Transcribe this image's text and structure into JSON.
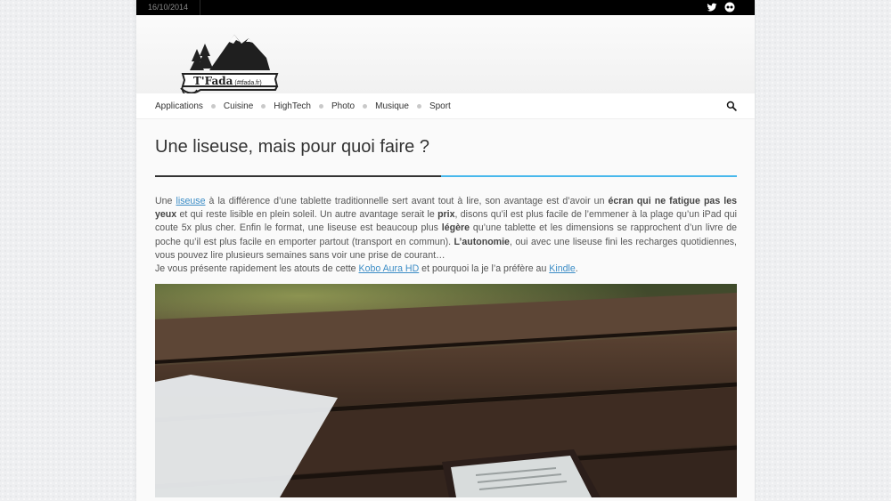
{
  "topbar": {
    "date": "16/10/2014"
  },
  "logo": {
    "name": "T'Fada",
    "domain": "(#tfada.fr)"
  },
  "nav": {
    "items": [
      "Applications",
      "Cuisine",
      "HighTech",
      "Photo",
      "Musique",
      "Sport"
    ]
  },
  "article": {
    "title": "Une liseuse, mais pour quoi faire ?",
    "p1": {
      "t1": "Une ",
      "link1": "liseuse",
      "t2": " à la différence d’une tablette traditionnelle sert avant tout à lire, son avantage est d’avoir un ",
      "b1": "écran qui ne fatigue pas les yeux",
      "t3": " et qui reste lisible en plein soleil. Un autre avantage serait le ",
      "b2": "prix",
      "t4": ", disons qu’il est plus facile de l’emmener à la plage qu’un iPad qui coute 5x plus cher. Enfin le format, une liseuse est beaucoup plus ",
      "b3": "légère",
      "t5": " qu’une tablette et les dimensions se rapprochent d’un livre de poche qu’il est plus facile en emporter partout (transport en commun). ",
      "b4": "L’autonomie",
      "t6": ", oui avec une liseuse fini les recharges quotidiennes, vous pouvez lire plusieurs semaines sans voir une prise de courant…"
    },
    "p2": {
      "t1": "Je vous présente rapidement les atouts de cette ",
      "link1": "Kobo Aura HD",
      "t2": " et pourquoi la je l’a préfère au ",
      "link2": "Kindle",
      "t3": "."
    }
  },
  "colors": {
    "accent": "#48b8ec",
    "link": "#3c8dc6",
    "topbar": "#000000"
  }
}
